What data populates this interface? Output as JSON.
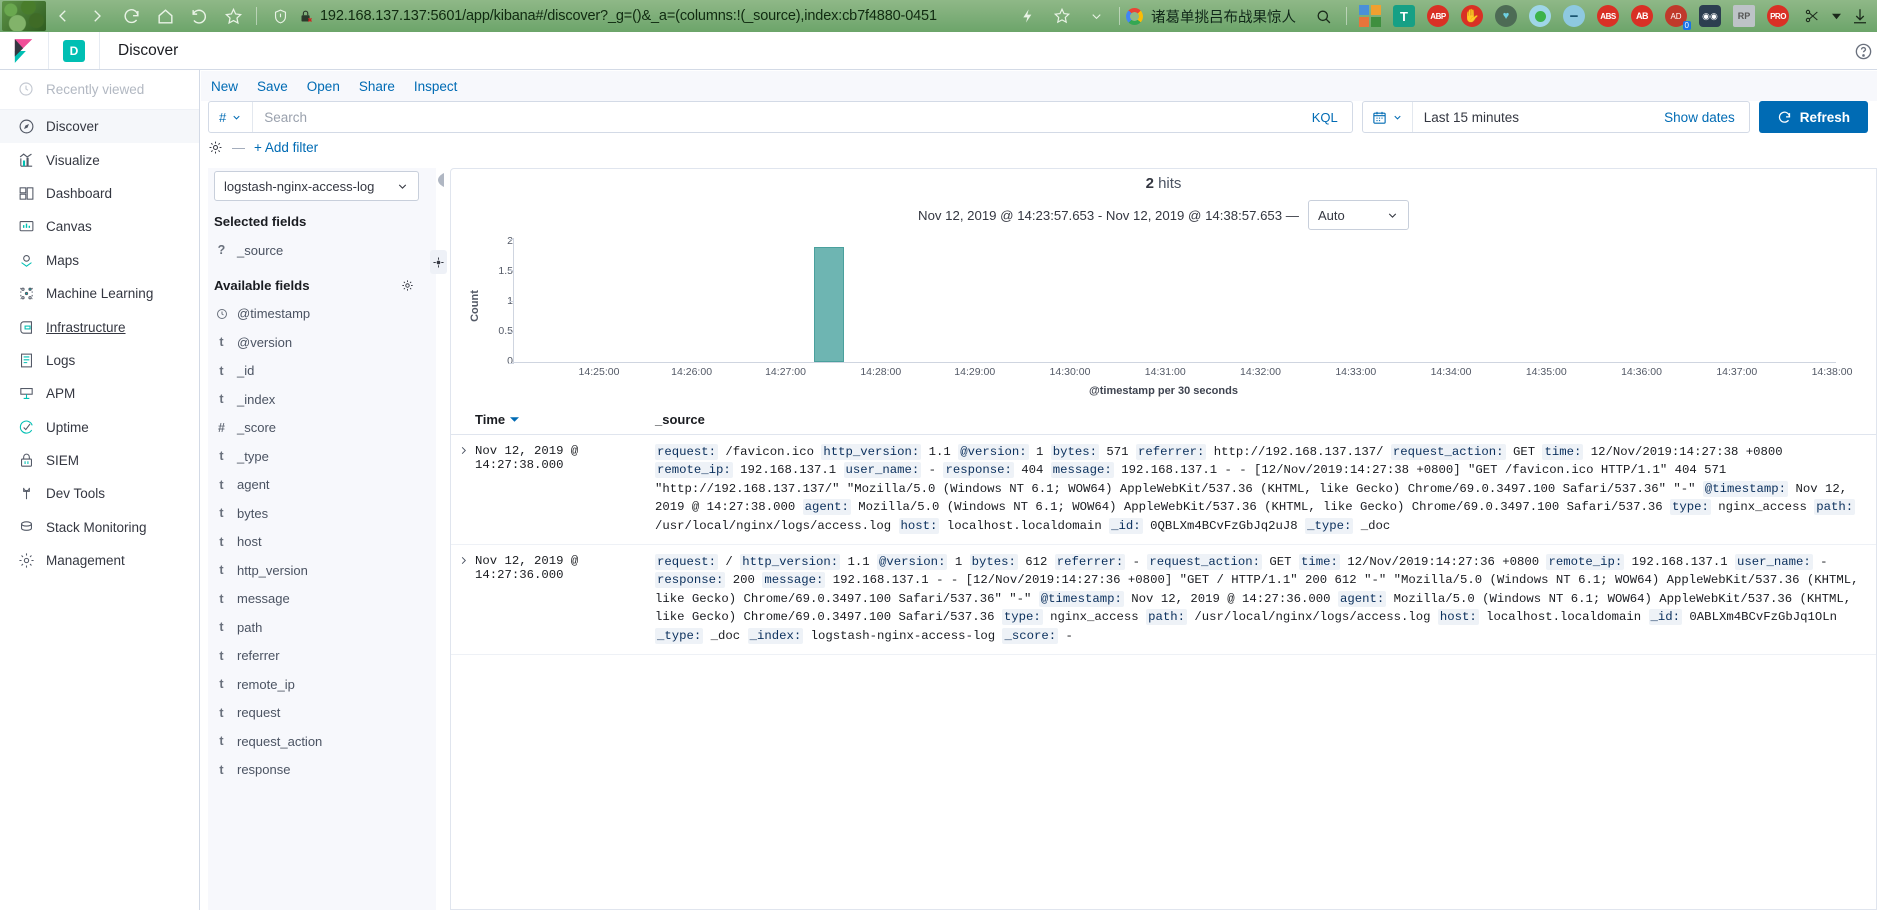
{
  "browser": {
    "nav_icons": [
      "back-arrow",
      "forward-arrow",
      "reload",
      "home",
      "history",
      "bookmark-star"
    ],
    "shield_icon": "shield-icon",
    "lock_icon": "lock-broken-icon",
    "url": "192.168.137.137:5601/app/kibana#/discover?_g=()&_a=(columns:!(_source),index:cb7f4880-0451",
    "lightning_icon": "lightning-icon",
    "star_icon": "star-icon",
    "chevron_icon": "chevron-down-icon",
    "search_engine": "google-icon",
    "search_term": "诸葛单挑吕布战果惊人",
    "search_icon": "search-icon",
    "extensions": [
      "ms-office-icon",
      "translate-icon",
      "abp-icon",
      "stop-hand-icon",
      "shield-heart-icon",
      "green-dot-icon",
      "minus-circle-icon",
      "abs-icon",
      "ab-icon",
      "adblock-badge-icon",
      "tampermonkey-icon",
      "rp-icon",
      "pro-icon",
      "scissors-icon",
      "download-icon"
    ],
    "badge_count": "0"
  },
  "kibana_header": {
    "logo": "kibana-logo",
    "app_badge": "D",
    "app_title": "Discover",
    "help_icon": "help-icon"
  },
  "nav": {
    "recently_viewed": "Recently viewed",
    "items": [
      {
        "label": "Discover",
        "icon": "compass-icon",
        "active": true
      },
      {
        "label": "Visualize",
        "icon": "bar-chart-icon",
        "active": false
      },
      {
        "label": "Dashboard",
        "icon": "dashboard-icon",
        "active": false
      },
      {
        "label": "Canvas",
        "icon": "canvas-icon",
        "active": false
      },
      {
        "label": "Maps",
        "icon": "map-marker-icon",
        "active": false
      },
      {
        "label": "Machine Learning",
        "icon": "machine-learning-icon",
        "active": false
      },
      {
        "label": "Infrastructure",
        "icon": "infrastructure-icon",
        "active": false
      },
      {
        "label": "Logs",
        "icon": "logs-icon",
        "active": false
      },
      {
        "label": "APM",
        "icon": "apm-icon",
        "active": false
      },
      {
        "label": "Uptime",
        "icon": "uptime-icon",
        "active": false
      },
      {
        "label": "SIEM",
        "icon": "lock-icon",
        "active": false
      },
      {
        "label": "Dev Tools",
        "icon": "wrench-icon",
        "active": false
      },
      {
        "label": "Stack Monitoring",
        "icon": "monitoring-icon",
        "active": false
      },
      {
        "label": "Management",
        "icon": "gear-icon",
        "active": false
      }
    ]
  },
  "toolbar": {
    "links": [
      "New",
      "Save",
      "Open",
      "Share",
      "Inspect"
    ]
  },
  "querybar": {
    "lang_symbol": "#",
    "search_placeholder": "Search",
    "search_value": "",
    "kql_label": "KQL",
    "calendar_icon": "calendar-icon",
    "date_range": "Last 15 minutes",
    "show_dates": "Show dates",
    "refresh_label": "Refresh",
    "refresh_icon": "refresh-icon"
  },
  "filterbar": {
    "gear_icon": "filter-settings-icon",
    "separator": "—",
    "add_filter": "+ Add filter"
  },
  "fields_panel": {
    "index_pattern": "logstash-nginx-access-log",
    "selected_fields_header": "Selected fields",
    "selected_fields": [
      {
        "type": "?",
        "name": "_source"
      }
    ],
    "available_fields_header": "Available fields",
    "settings_icon": "gear-icon",
    "available_fields": [
      {
        "type": "clock",
        "name": "@timestamp"
      },
      {
        "type": "t",
        "name": "@version"
      },
      {
        "type": "t",
        "name": "_id"
      },
      {
        "type": "t",
        "name": "_index"
      },
      {
        "type": "#",
        "name": "_score"
      },
      {
        "type": "t",
        "name": "_type"
      },
      {
        "type": "t",
        "name": "agent"
      },
      {
        "type": "t",
        "name": "bytes"
      },
      {
        "type": "t",
        "name": "host"
      },
      {
        "type": "t",
        "name": "http_version"
      },
      {
        "type": "t",
        "name": "message"
      },
      {
        "type": "t",
        "name": "path"
      },
      {
        "type": "t",
        "name": "referrer"
      },
      {
        "type": "t",
        "name": "remote_ip"
      },
      {
        "type": "t",
        "name": "request"
      },
      {
        "type": "t",
        "name": "request_action"
      },
      {
        "type": "t",
        "name": "response"
      }
    ]
  },
  "main": {
    "hits_count": "2",
    "hits_label": "hits",
    "time_range_text": "Nov 12, 2019 @ 14:23:57.653 - Nov 12, 2019 @ 14:38:57.653 —",
    "interval_value": "Auto",
    "collapse_icon": "chevron-left-icon",
    "columns": {
      "time": "Time",
      "source": "_source",
      "sort_icon": "sort-desc-icon"
    }
  },
  "chart_data": {
    "type": "bar",
    "title": "",
    "xlabel": "@timestamp per 30 seconds",
    "ylabel": "Count",
    "ylim": [
      0,
      2
    ],
    "yticks": [
      "0",
      "0.5",
      "1",
      "1.5",
      "2"
    ],
    "xticks": [
      "14:25:00",
      "14:26:00",
      "14:27:00",
      "14:28:00",
      "14:29:00",
      "14:30:00",
      "14:31:00",
      "14:32:00",
      "14:33:00",
      "14:34:00",
      "14:35:00",
      "14:36:00",
      "14:37:00",
      "14:38:00"
    ],
    "bar_color": "#6eb5b2",
    "categories": [
      "14:27:30"
    ],
    "values": [
      2
    ],
    "grid": false,
    "legend": "none"
  },
  "documents": [
    {
      "time": "Nov 12, 2019 @ 14:27:38.000",
      "pairs": [
        {
          "k": "request:",
          "v": " /favicon.ico "
        },
        {
          "k": "http_version:",
          "v": " 1.1 "
        },
        {
          "k": "@version:",
          "v": " 1 "
        },
        {
          "k": "bytes:",
          "v": " 571 "
        },
        {
          "k": "referrer:",
          "v": " http://192.168.137.137/ "
        },
        {
          "k": "request_action:",
          "v": " GET "
        },
        {
          "k": "time:",
          "v": " 12/Nov/2019:14:27:38 +0800 "
        },
        {
          "k": "remote_ip:",
          "v": " 192.168.137.1 "
        },
        {
          "k": "user_name:",
          "v": " - "
        },
        {
          "k": "response:",
          "v": " 404 "
        },
        {
          "k": "message:",
          "v": " 192.168.137.1 - - [12/Nov/2019:14:27:38 +0800] \"GET /favicon.ico HTTP/1.1\" 404 571 \"http://192.168.137.137/\" \"Mozilla/5.0 (Windows NT 6.1; WOW64) AppleWebKit/537.36 (KHTML, like Gecko) Chrome/69.0.3497.100 Safari/537.36\" \"-\" "
        },
        {
          "k": "@timestamp:",
          "v": " Nov 12, 2019 @ 14:27:38.000 "
        },
        {
          "k": "agent:",
          "v": " Mozilla/5.0 (Windows NT 6.1; WOW64) AppleWebKit/537.36 (KHTML, like Gecko) Chrome/69.0.3497.100 Safari/537.36 "
        },
        {
          "k": "type:",
          "v": " nginx_access "
        },
        {
          "k": "path:",
          "v": " /usr/local/nginx/logs/access.log "
        },
        {
          "k": "host:",
          "v": " localhost.localdomain "
        },
        {
          "k": "_id:",
          "v": " 0QBLXm4BCvFzGbJq2uJ8 "
        },
        {
          "k": "_type:",
          "v": " _doc"
        }
      ]
    },
    {
      "time": "Nov 12, 2019 @ 14:27:36.000",
      "pairs": [
        {
          "k": "request:",
          "v": " / "
        },
        {
          "k": "http_version:",
          "v": " 1.1 "
        },
        {
          "k": "@version:",
          "v": " 1 "
        },
        {
          "k": "bytes:",
          "v": " 612 "
        },
        {
          "k": "referrer:",
          "v": " - "
        },
        {
          "k": "request_action:",
          "v": " GET "
        },
        {
          "k": "time:",
          "v": " 12/Nov/2019:14:27:36 +0800 "
        },
        {
          "k": "remote_ip:",
          "v": " 192.168.137.1 "
        },
        {
          "k": "user_name:",
          "v": " - "
        },
        {
          "k": "response:",
          "v": " 200 "
        },
        {
          "k": "message:",
          "v": " 192.168.137.1 - - [12/Nov/2019:14:27:36 +0800] \"GET / HTTP/1.1\" 200 612 \"-\" \"Mozilla/5.0 (Windows NT 6.1; WOW64) AppleWebKit/537.36 (KHTML, like Gecko) Chrome/69.0.3497.100 Safari/537.36\" \"-\" "
        },
        {
          "k": "@timestamp:",
          "v": " Nov 12, 2019 @ 14:27:36.000 "
        },
        {
          "k": "agent:",
          "v": " Mozilla/5.0 (Windows NT 6.1; WOW64) AppleWebKit/537.36 (KHTML, like Gecko) Chrome/69.0.3497.100 Safari/537.36 "
        },
        {
          "k": "type:",
          "v": " nginx_access "
        },
        {
          "k": "path:",
          "v": " /usr/local/nginx/logs/access.log "
        },
        {
          "k": "host:",
          "v": " localhost.localdomain "
        },
        {
          "k": "_id:",
          "v": " 0ABLXm4BCvFzGbJq1OLn "
        },
        {
          "k": "_type:",
          "v": " _doc "
        },
        {
          "k": "_index:",
          "v": " logstash-nginx-access-log "
        },
        {
          "k": "_score:",
          "v": " -"
        }
      ]
    }
  ]
}
